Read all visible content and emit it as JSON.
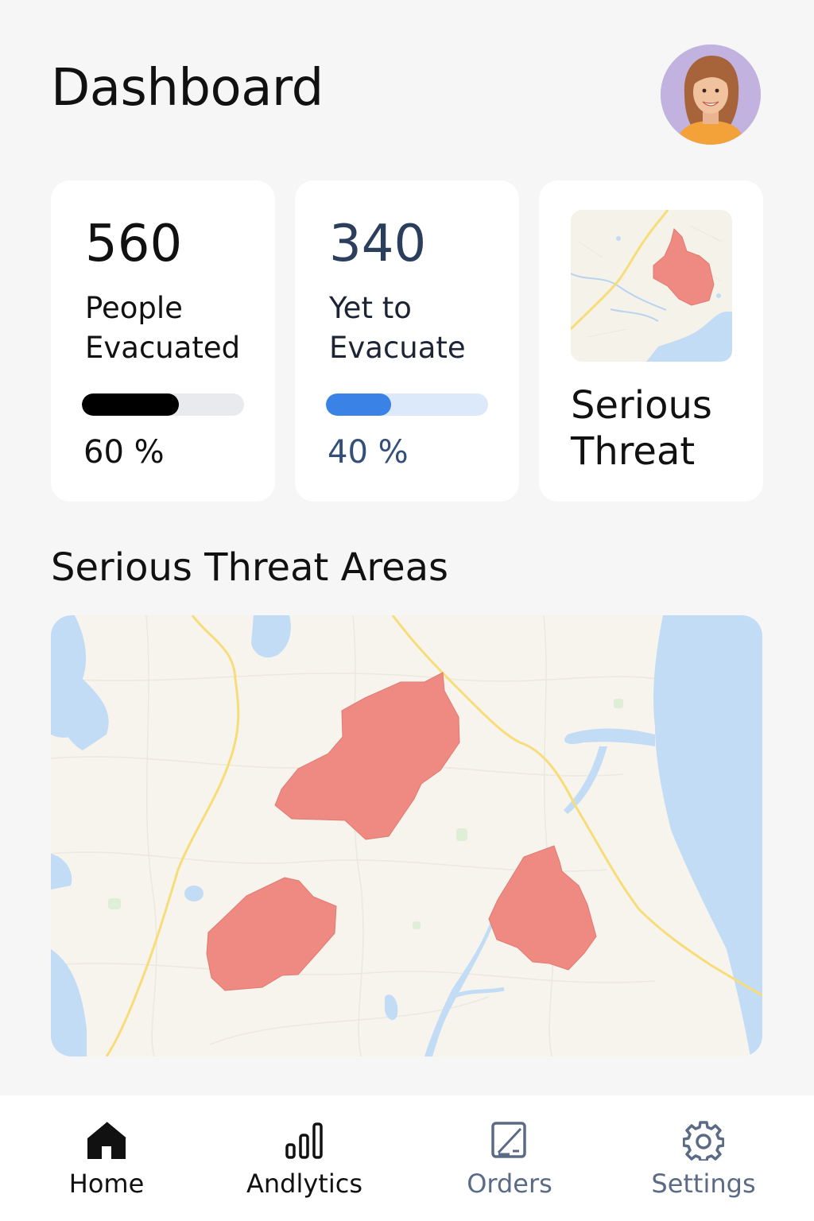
{
  "header": {
    "title": "Dashboard",
    "avatar_icon": "user-avatar-icon"
  },
  "stats": {
    "evacuated": {
      "value": "560",
      "label_line1": "People",
      "label_line2": "Evacuated",
      "percent_text": "60 %",
      "progress": 0.6,
      "bar_color": "#000000",
      "track_color": "#e9eaed"
    },
    "remaining": {
      "value": "340",
      "label_line1": "Yet to",
      "label_line2": "Evacuate",
      "percent_text": "40 %",
      "progress": 0.4,
      "bar_color": "#3b82e6",
      "track_color": "#dce9fa"
    },
    "threat": {
      "label_line1": "Serious",
      "label_line2": "Threat",
      "map_icon": "threat-map-thumbnail"
    }
  },
  "threat_section": {
    "title": "Serious Threat Areas",
    "zone_color": "#ef8a82",
    "water_color": "#c3dcf5",
    "road_color": "#f7dd7a",
    "land_color": "#f7f4ee"
  },
  "nav": {
    "items": [
      {
        "label": "Home",
        "icon": "home-icon",
        "active": true
      },
      {
        "label": "Andlytics",
        "icon": "bar-chart-icon",
        "active": false
      },
      {
        "label": "Orders",
        "icon": "orders-icon",
        "active": false
      },
      {
        "label": "Settings",
        "icon": "gear-icon",
        "active": false
      }
    ]
  }
}
